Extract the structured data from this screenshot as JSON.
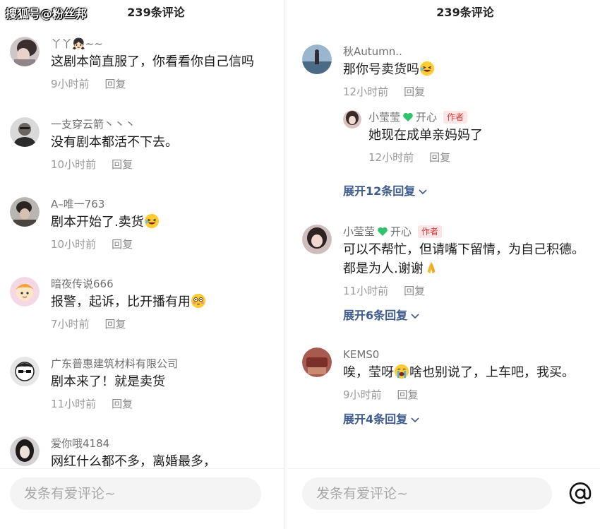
{
  "watermark": "搜狐号@粉丝邦",
  "left_panel": {
    "title": "239条评论",
    "comments": [
      {
        "username": "丫丫👧🏻~~",
        "text": "这剧本简直服了，你看看你自己信吗",
        "time": "9小时前",
        "reply": "回复"
      },
      {
        "username": "一支穿云箭丶丶丶",
        "text": "没有剧本都活不下去。",
        "time": "10小时前",
        "reply": "回复"
      },
      {
        "username": "A–唯一763",
        "text": "剧本开始了.卖货",
        "time": "10小时前",
        "reply": "回复"
      },
      {
        "username": "暗夜传说666",
        "text": "报警，起诉，比开播有用",
        "time": "7小时前",
        "reply": "回复"
      },
      {
        "username": "广东普惠建筑材料有限公司",
        "text": "剧本来了！就是卖货",
        "time": "11小时前",
        "reply": "回复"
      },
      {
        "username": "爱你哦4184",
        "text": "网红什么都不多，离婚最多，",
        "time": "",
        "reply": ""
      }
    ],
    "input_placeholder": "发条有爱评论~"
  },
  "right_panel": {
    "title": "239条评论",
    "comments": [
      {
        "username": "秋Autumn..",
        "text": "那你号卖货吗",
        "time": "12小时前",
        "reply": "回复",
        "replies": [
          {
            "username": "小莹莹",
            "username_suffix": "开心",
            "badge": "作者",
            "text": "她现在成单亲妈妈了",
            "time": "12小时前",
            "reply": "回复"
          }
        ],
        "expand_label": "展开12条回复"
      },
      {
        "username": "小莹莹",
        "username_suffix": "开心",
        "badge": "作者",
        "text": "可以不帮忙，但请嘴下留情，为自己积德。都是为人.谢谢",
        "time": "11小时前",
        "reply": "回复",
        "expand_label": "展开6条回复"
      },
      {
        "username": "KEMS0",
        "text_a": "唉，莹呀",
        "text_b": "啥也别说了，上车吧，我买。",
        "time": "9小时前",
        "reply": "回复",
        "expand_label": "展开4条回复"
      }
    ],
    "input_placeholder": "发条有爱评论~"
  },
  "colors": {
    "author_badge_bg": "#fde6e6",
    "author_badge_text": "#e0363b",
    "expand_link": "#3d5b8f",
    "heart": "#2fc46b"
  },
  "icons": [
    "at-icon",
    "chevron-down-icon",
    "green-heart-icon",
    "laughing-emoji-icon",
    "flushed-emoji-icon",
    "crying-emoji-icon",
    "praying-hands-emoji-icon"
  ]
}
